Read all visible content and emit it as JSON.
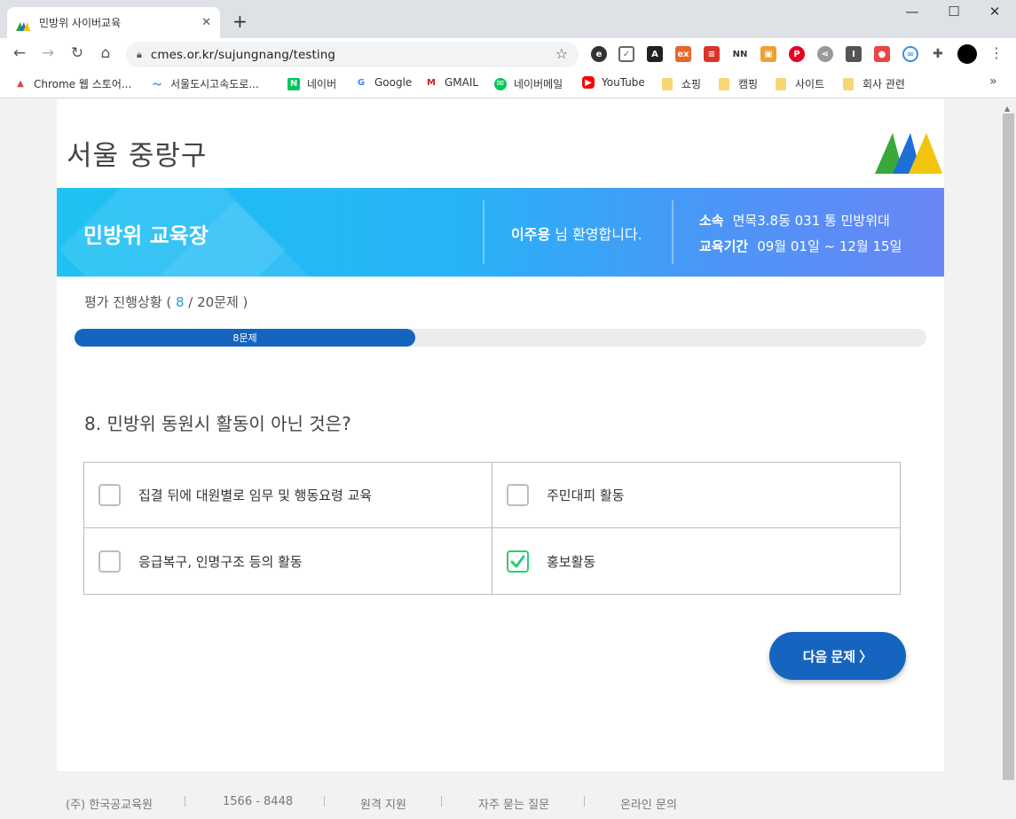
{
  "browser": {
    "tab_title": "민방위 사이버교육",
    "tab_close": "✕",
    "new_tab": "+",
    "url": "cmes.or.kr/sujungnang/testing",
    "minimize": "—",
    "maximize": "☐",
    "close": "✕",
    "bookmarks": [
      {
        "label": "Chrome 웹 스토어..."
      },
      {
        "label": "서울도시고속도로..."
      },
      {
        "label": "네이버"
      },
      {
        "label": "Google"
      },
      {
        "label": "GMAIL"
      },
      {
        "label": "네이버메일"
      },
      {
        "label": "YouTube"
      },
      {
        "label": "쇼핑"
      },
      {
        "label": "캠핑"
      },
      {
        "label": "사이트"
      },
      {
        "label": "회사 관련"
      }
    ],
    "bookmark_more": "»"
  },
  "page": {
    "site_title": "서울 중랑구",
    "banner": {
      "title": "민방위 교육장",
      "user_name": "이주용",
      "welcome_suffix": " 님 환영합니다.",
      "affiliation_label": "소속",
      "affiliation_value": "면목3.8동 031 통 민방위대",
      "period_label": "교육기간",
      "period_value": "09월 01일 ~ 12월 15일"
    },
    "progress": {
      "prefix": "평가 진행상황 ( ",
      "current": "8",
      "suffix": " / 20문제 )",
      "bar_label": "8문제",
      "fraction": 0.4
    },
    "question": "8. 민방위 동원시 활동이 아닌 것은?",
    "options": [
      {
        "text": "집결 뒤에 대원별로 임무 및 행동요령 교육",
        "checked": false
      },
      {
        "text": "주민대피 활동",
        "checked": false
      },
      {
        "text": "응급복구, 인명구조 등의 활동",
        "checked": false
      },
      {
        "text": "홍보활동",
        "checked": true
      }
    ],
    "next_button": "다음 문제 〉",
    "footer": [
      "(주) 한국공교육원",
      "1566 - 8448",
      "원격 지원",
      "자주 묻는 질문",
      "온라인 문의"
    ]
  },
  "colors": {
    "primary": "#1565c0",
    "accent_check": "#2ecc71",
    "banner_start": "#1fc2f3",
    "banner_end": "#6a86f5"
  }
}
